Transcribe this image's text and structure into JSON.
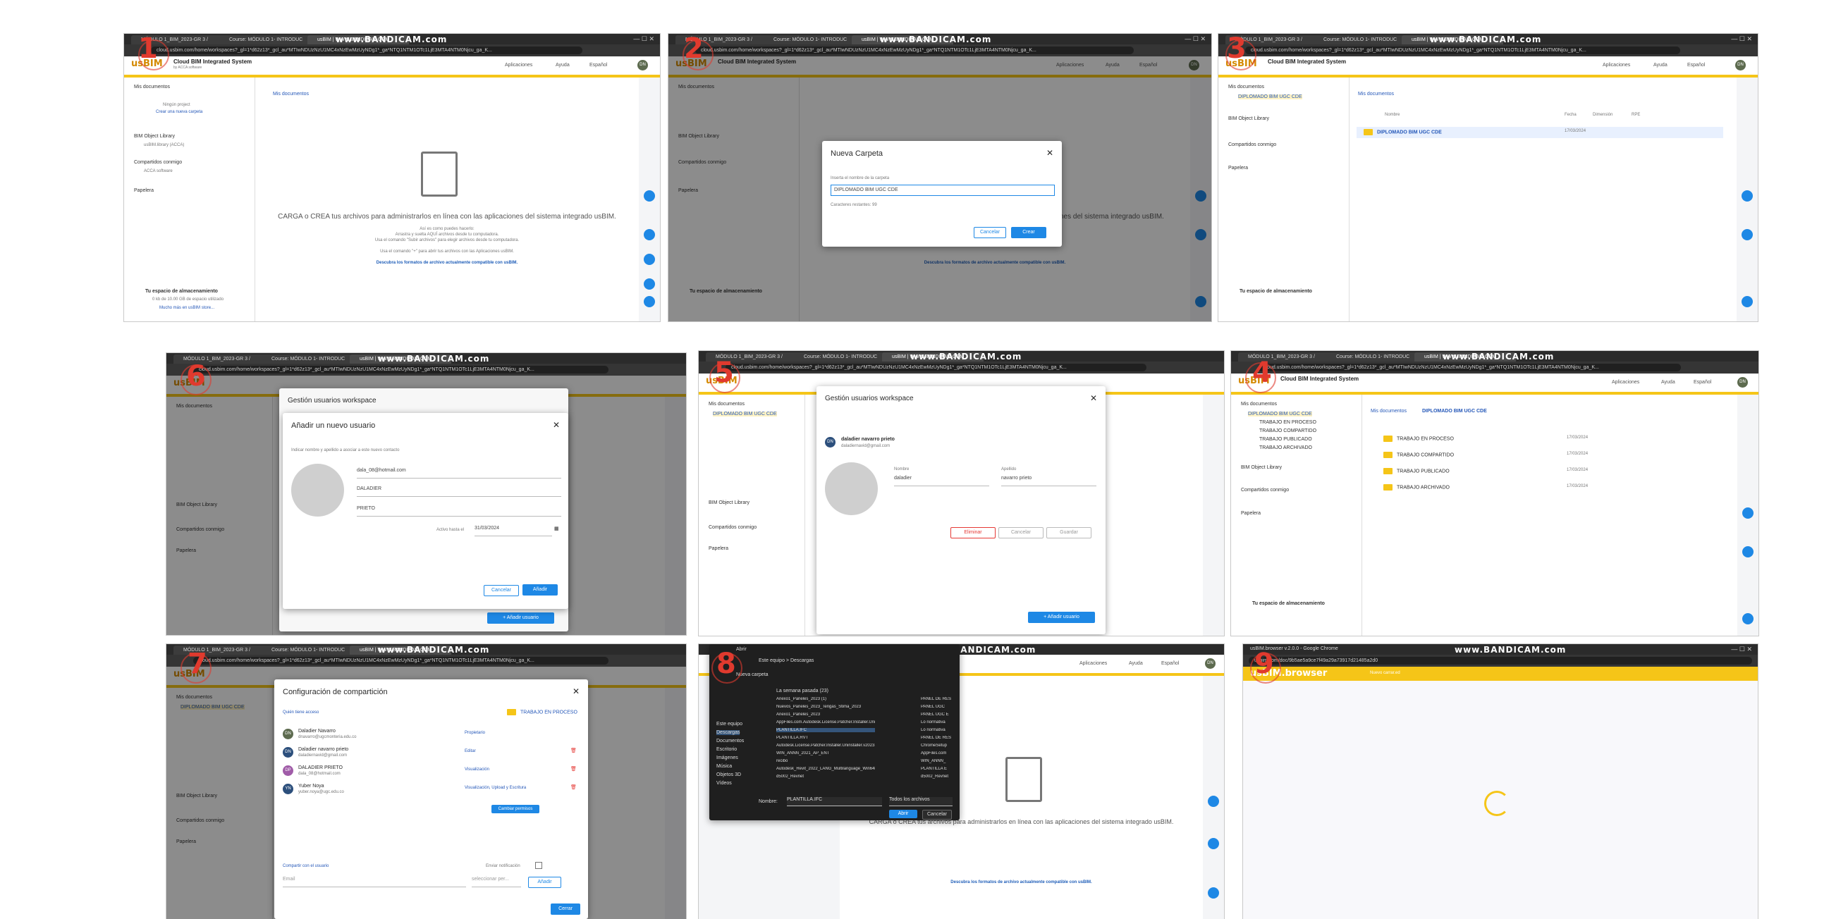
{
  "browser": {
    "tabs": [
      "MÓDULO 1_BIM_2023-GR 3 /",
      "Course: MÓDULO 1- INTRODUC",
      "usBIM | WWW.BANDICAM.COM"
    ],
    "url": "cloud.usbim.com/home/workspaces?_gl=1*d62z13*_gcl_au*MTIwNDUzNzU1MC4xNzEwMzUyNDg1*_ga*NTQ1NTM1OTc1LjE3MTA4NTM0Njcu_ga_K...",
    "watermark": "www.BANDICAM.com"
  },
  "app": {
    "logo": "usBIM",
    "title": "Cloud BIM Integrated System",
    "subtitle": "by ACCA software",
    "menu_apps": "Aplicaciones",
    "menu_help": "Ayuda",
    "menu_lang": "Español",
    "avatar_initials": "DN"
  },
  "sidebar": {
    "my_docs": "Mis documentos",
    "no_projects": "Ningún project",
    "create_project": "Crear una nueva carpeta",
    "bim_library": "BIM Object Library",
    "bim_library_sub": "usBIM.library (ACCA)",
    "shared": "Compartidos conmigo",
    "shared_sub": "ACCA software",
    "trash": "Papelera",
    "storage": "Tu espacio de almacenamiento",
    "storage_sub": "0 kb de 10.00 GB de espacio utilizado",
    "more": "Mucho más en usBIM store..."
  },
  "empty_state": {
    "main": "CARGA o CREA tus archivos para administrarlos en línea con las aplicaciones del sistema integrado usBIM.",
    "line1": "Así es como puedes hacerlo:",
    "line2": "Arrastra y suelta AQUÍ archivos desde tu computadora.",
    "line3": "Usa el comando \"Subir archivos\" para elegir archivos desde tu computadora.",
    "line4": "Usa el comando \"+\" para abrir tus archivos con las Aplicaciones usBIM.",
    "link": "Descubra los formatos de archivo actualmente compatible con usBIM."
  },
  "panels": {
    "p1": {
      "step": "1",
      "breadcrumb": "Mis documentos"
    },
    "p2": {
      "step": "2",
      "dialog_title": "Nueva Carpeta",
      "label": "Inserta el nombre de la carpeta",
      "value": "DIPLOMADO BIM UGC CDE",
      "counter": "Caracteres restantes: 99",
      "cancel": "Cancelar",
      "create": "Crear"
    },
    "p3": {
      "step": "3",
      "breadcrumb": "Mis documentos",
      "columns": [
        "Nombre",
        "Fecha",
        "Dimensión",
        "RPE"
      ],
      "folder": "DIPLOMADO BIM UGC CDE",
      "date": "17/03/2024"
    },
    "p4": {
      "step": "4",
      "breadcrumb_root": "Mis documentos",
      "breadcrumb_current": "DIPLOMADO BIM UGC CDE",
      "sidebar_folder": "DIPLOMADO BIM UGC CDE",
      "folders": [
        "TRABAJO EN PROCESO",
        "TRABAJO COMPARTIDO",
        "TRABAJO PUBLICADO",
        "TRABAJO ARCHIVADO"
      ],
      "date": "17/03/2024"
    },
    "p5": {
      "step": "5",
      "dialog_title": "Gestión usuarios workspace",
      "user_name": "daladier navarro prieto",
      "user_email": "daladiernavid@gmail.com",
      "first_label": "Nombre",
      "first_value": "daladier",
      "last_label": "Apellido",
      "last_value": "navarro prieto",
      "delete": "Eliminar",
      "cancel": "Cancelar",
      "save": "Guardar",
      "add_user": "+ Añadir usuario"
    },
    "p6": {
      "step": "6",
      "outer_title": "Gestión usuarios workspace",
      "dialog_title": "Añadir un nuevo usuario",
      "hint": "Indicar nombre y apellido a asociar a este nuevo contacto",
      "email": "dala_08@hotmail.com",
      "first": "DALADIER",
      "last": "PRIETO",
      "active_label": "Activo hasta el",
      "active_date": "31/03/2024",
      "cancel": "Cancelar",
      "add": "Añadir",
      "add_user": "+ Añadir usuario"
    },
    "p7": {
      "step": "7",
      "dialog_title": "Configuración de compartición",
      "who": "Quién tiene acceso",
      "folder": "TRABAJO EN PROCESO",
      "users": [
        {
          "initials": "DN",
          "name": "Daladier Navarro",
          "email": "dnavarro@ugcmonteria.edu.co",
          "role": "Propietario",
          "color": "#5d6b4f"
        },
        {
          "initials": "DN",
          "name": "Daladier navarro prieto",
          "email": "daladiernavid@gmail.com",
          "role": "Editar",
          "color": "#2c4f7c"
        },
        {
          "initials": "DP",
          "name": "DALADIER PRIETO",
          "email": "dala_08@hotmail.com",
          "role": "Visualización",
          "color": "#a05ca8"
        },
        {
          "initials": "YN",
          "name": "Yuber Noya",
          "email": "yuber.noya@ugc.edu.co",
          "role": "Visualización, Upload y Escritura",
          "color": "#2c4f7c"
        }
      ],
      "tooltip": "Cambiar permisos",
      "share_label": "Compartir con el usuario",
      "email_placeholder": "Email",
      "permission_placeholder": "seleccionar per...",
      "notify": "Enviar notificación",
      "add": "Añadir",
      "close": "Cerrar"
    },
    "p8": {
      "step": "8",
      "dialog_title": "Abrir",
      "path": "Este equipo > Descargas",
      "new_folder": "Nueva carpeta",
      "group": "La semana pasada (23)",
      "nav": [
        "Este equipo",
        "Descargas",
        "Documentos",
        "Escritorio",
        "Imágenes",
        "Música",
        "Objetos 3D",
        "Vídeos"
      ],
      "files": [
        "Anexo1_Paneles_2023 (1)",
        "Nuevos_Paneles_2023_Tengas_Stima_2023",
        "Anexo1_Paneles_2023",
        "AppFiles.com.Autodesk.License.Patcher.Installer.Uninstaller.v2023.09.06",
        "PLANTILLA.IFC",
        "PLANTILLA.RVT",
        "Autodesk.License.Patcher.Installer.Uninstaller.v2023.07.17",
        "WIN_ANNN_2021_AP_ENT",
        "recibo",
        "Autodesk_Revit_2022_LANG_Multilanguage_Win64bit",
        "d5002_Revnet"
      ],
      "files_right": [
        "PANEL DE RES",
        "PANEL UGC",
        "PANEL UGC E",
        "Lo normativa",
        "Lo normativa",
        "PANEL DE RES",
        "ChromeSetup",
        "AppFiles.com",
        "WIN_ANNN_",
        "PLANTILLA E",
        "d5002_Revnet"
      ],
      "filename_label": "Nombre:",
      "filename": "PLANTILLA.IFC",
      "filter": "Todos los archivos",
      "open": "Abrir",
      "cancel": "Cancelar"
    },
    "p9": {
      "step": "9",
      "window_title": "usBIM.browser v.2.0.0 - Google Chrome",
      "url": "usbim.com/doc/9b5ae5a9ce7f49a29a73917d21485a2d0",
      "logo": "usBIM.browser",
      "file_label": "Nuevo carrar.ed"
    }
  }
}
